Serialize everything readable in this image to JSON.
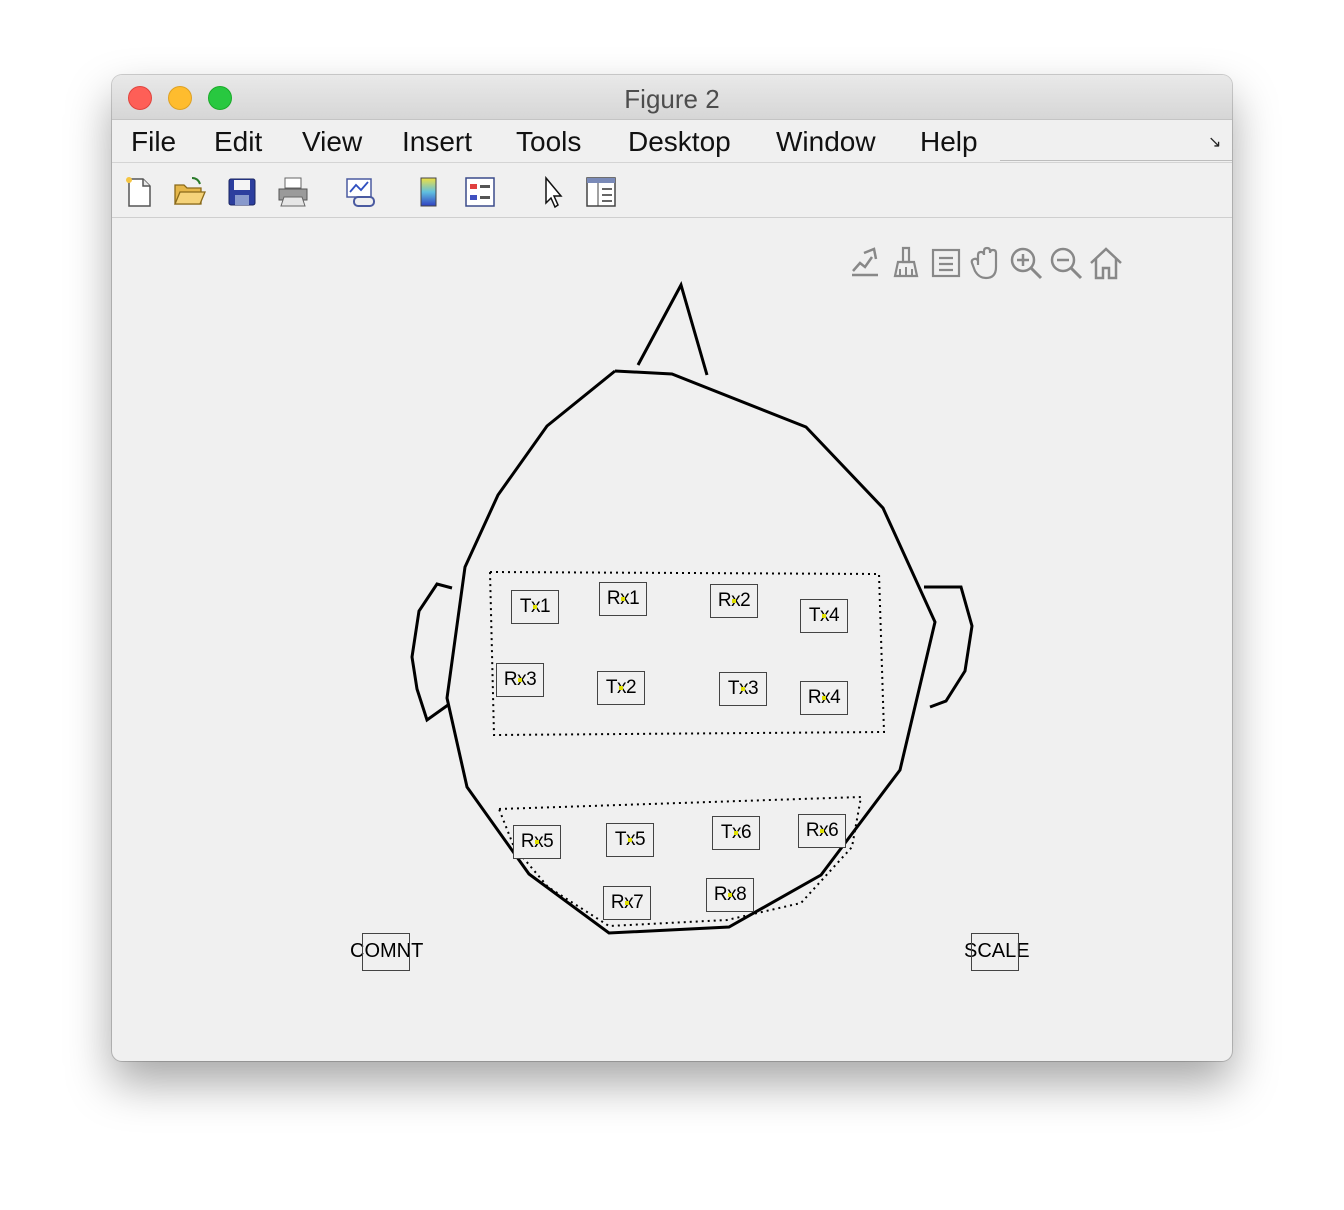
{
  "window": {
    "title": "Figure 2"
  },
  "menu": [
    "File",
    "Edit",
    "View",
    "Insert",
    "Tools",
    "Desktop",
    "Window",
    "Help"
  ],
  "toolbar_icons": [
    "new-figure-icon",
    "open-file-icon",
    "save-icon",
    "print-icon",
    "link-plot-icon",
    "colorbar-icon",
    "legend-icon",
    "edit-plot-arrow-icon",
    "property-editor-icon"
  ],
  "axes_toolbar_icons": [
    "export-icon",
    "brush-icon",
    "data-tips-icon",
    "pan-hand-icon",
    "zoom-in-icon",
    "zoom-out-icon",
    "home-icon"
  ],
  "channels": {
    "tx1": "Tx1",
    "rx1": "Rx1",
    "rx2": "Rx2",
    "tx4": "Tx4",
    "rx3": "Rx3",
    "tx2": "Tx2",
    "tx3": "Tx3",
    "rx4": "Rx4",
    "rx5": "Rx5",
    "tx5": "Tx5",
    "tx6": "Tx6",
    "rx6": "Rx6",
    "rx7": "Rx7",
    "rx8": "Rx8"
  },
  "extras": {
    "comnt": "COMNT",
    "scale": "SCALE"
  },
  "colors": {
    "marker": "#e0e000",
    "close": "#fe5f57",
    "minimize": "#febc2e",
    "maximize": "#28c840"
  }
}
